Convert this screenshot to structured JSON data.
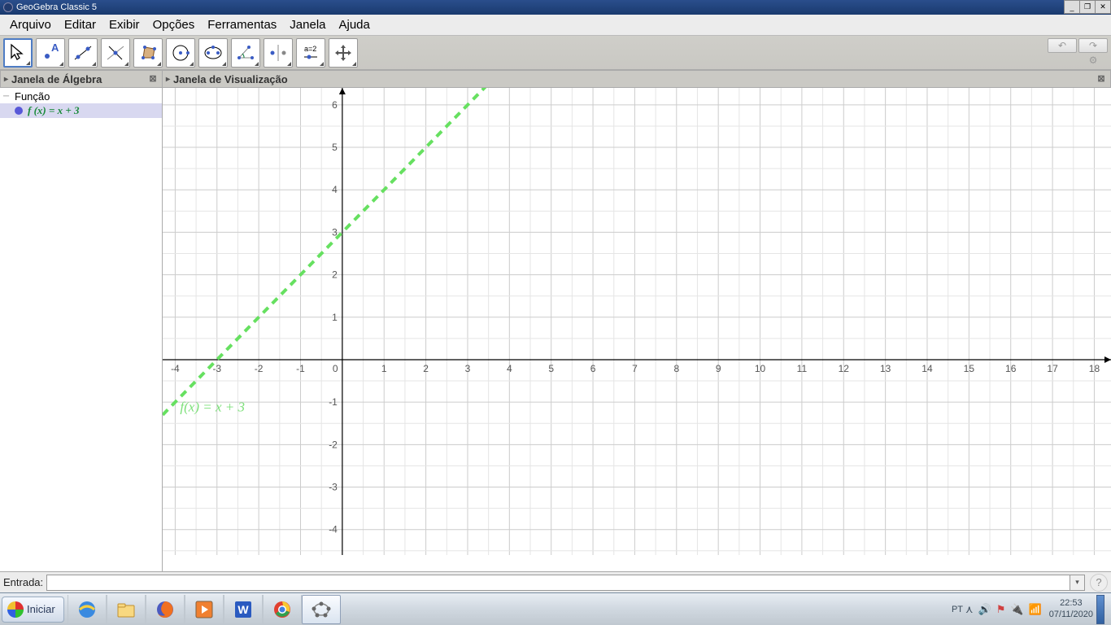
{
  "window": {
    "title": "GeoGebra Classic 5"
  },
  "menubar": [
    "Arquivo",
    "Editar",
    "Exibir",
    "Opções",
    "Ferramentas",
    "Janela",
    "Ajuda"
  ],
  "toolbar_tools": [
    "move",
    "point",
    "line",
    "perpendicular",
    "polygon",
    "circle",
    "ellipse",
    "angle",
    "reflect",
    "slider",
    "move-view"
  ],
  "panels": {
    "algebra_title": "Janela de Álgebra",
    "graphics_title": "Janela de Visualização"
  },
  "algebra": {
    "category": "Função",
    "items": [
      {
        "color": "#3838c0",
        "text": "f (x)  =  x + 3"
      }
    ]
  },
  "chart_data": {
    "type": "line",
    "title": "",
    "xlabel": "",
    "ylabel": "",
    "xlim": [
      -4.3,
      18.4
    ],
    "ylim": [
      -4.6,
      6.4
    ],
    "x_ticks": [
      -4,
      -3,
      -2,
      -1,
      0,
      1,
      2,
      3,
      4,
      5,
      6,
      7,
      8,
      9,
      10,
      11,
      12,
      13,
      14,
      15,
      16,
      17,
      18
    ],
    "y_ticks": [
      -4,
      -3,
      -2,
      -1,
      1,
      2,
      3,
      4,
      5,
      6
    ],
    "series": [
      {
        "name": "f(x) = x + 3",
        "expr": "x + 3",
        "color": "#66e060",
        "style": "dashed",
        "points": [
          [
            -4.3,
            -1.3
          ],
          [
            18.4,
            21.4
          ]
        ],
        "label": "f(x)  =  x + 3",
        "label_pos": [
          -4.0,
          -1.1
        ]
      }
    ],
    "grid": true
  },
  "input": {
    "label": "Entrada:",
    "value": ""
  },
  "taskbar": {
    "start": "Iniciar",
    "items": [
      "ie",
      "explorer",
      "firefox",
      "media",
      "word",
      "chrome",
      "geogebra"
    ],
    "tray": {
      "lang": "PT",
      "time": "22:53",
      "date": "07/11/2020"
    }
  }
}
